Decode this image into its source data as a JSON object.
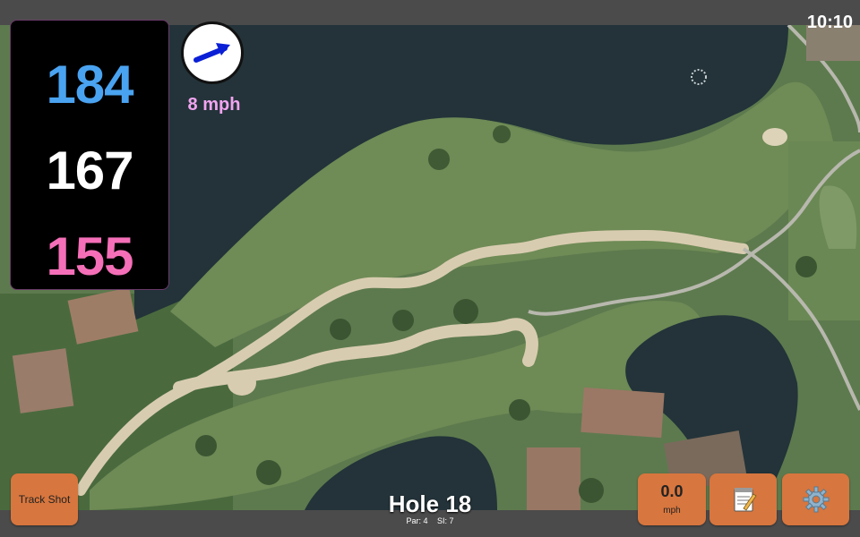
{
  "status": {
    "time": "10:10"
  },
  "distances": {
    "back": "184",
    "center": "167",
    "front": "155"
  },
  "wind": {
    "speed_label": "8 mph",
    "direction_icon": "wind-arrow-icon",
    "arrow_color": "#0a1fd6"
  },
  "hole": {
    "title": "Hole 18",
    "par_label": "Par: 4",
    "si_label": "SI: 7"
  },
  "buttons": {
    "track_shot": "Track Shot",
    "wind_value": "0.0",
    "wind_unit": "mph",
    "notes_icon": "notepad-icon",
    "settings_icon": "gear-icon"
  },
  "colors": {
    "back": "#4aa3f0",
    "center": "#ffffff",
    "front": "#f56fb8",
    "button": "#d7763e",
    "wind_text": "#f2a4f0"
  }
}
